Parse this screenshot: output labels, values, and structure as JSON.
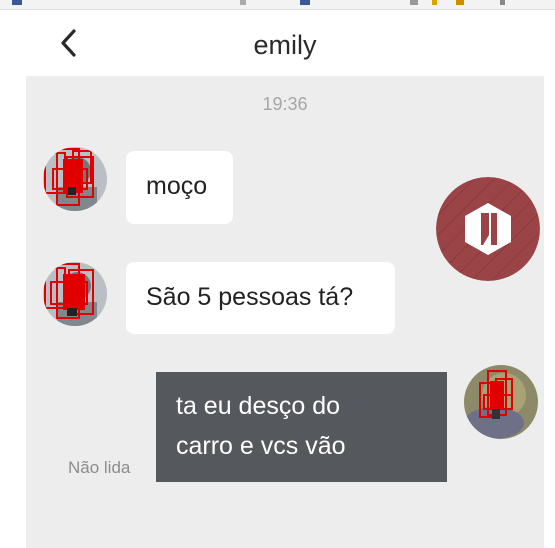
{
  "header": {
    "title": "emily",
    "back_icon": "chevron-left-icon"
  },
  "chat": {
    "time": "19:36",
    "messages": [
      {
        "text": "moço",
        "direction": "incoming"
      },
      {
        "text": "São 5 pessoas tá?",
        "direction": "incoming"
      },
      {
        "lines": [
          "ta eu desço do",
          "carro  e vcs vão"
        ],
        "direction": "outgoing",
        "status": "Não lida"
      }
    ]
  },
  "floating_button": {
    "icon": "app-logo-icon"
  },
  "colors": {
    "chat_background": "#ededed",
    "incoming_bubble": "#ffffff",
    "outgoing_bubble": "#55585c",
    "float_button": "#9b4447",
    "redaction": "#e00000"
  }
}
